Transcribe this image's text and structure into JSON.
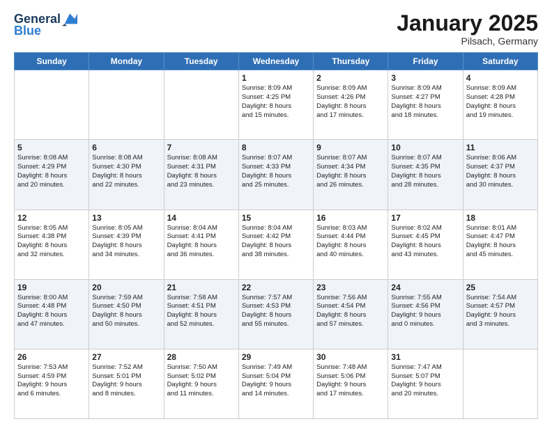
{
  "header": {
    "logo_line1": "General",
    "logo_line2": "Blue",
    "month_title": "January 2025",
    "location": "Pilsach, Germany"
  },
  "days_of_week": [
    "Sunday",
    "Monday",
    "Tuesday",
    "Wednesday",
    "Thursday",
    "Friday",
    "Saturday"
  ],
  "weeks": [
    [
      {
        "day": "",
        "info": ""
      },
      {
        "day": "",
        "info": ""
      },
      {
        "day": "",
        "info": ""
      },
      {
        "day": "1",
        "info": "Sunrise: 8:09 AM\nSunset: 4:25 PM\nDaylight: 8 hours\nand 15 minutes."
      },
      {
        "day": "2",
        "info": "Sunrise: 8:09 AM\nSunset: 4:26 PM\nDaylight: 8 hours\nand 17 minutes."
      },
      {
        "day": "3",
        "info": "Sunrise: 8:09 AM\nSunset: 4:27 PM\nDaylight: 8 hours\nand 18 minutes."
      },
      {
        "day": "4",
        "info": "Sunrise: 8:09 AM\nSunset: 4:28 PM\nDaylight: 8 hours\nand 19 minutes."
      }
    ],
    [
      {
        "day": "5",
        "info": "Sunrise: 8:08 AM\nSunset: 4:29 PM\nDaylight: 8 hours\nand 20 minutes."
      },
      {
        "day": "6",
        "info": "Sunrise: 8:08 AM\nSunset: 4:30 PM\nDaylight: 8 hours\nand 22 minutes."
      },
      {
        "day": "7",
        "info": "Sunrise: 8:08 AM\nSunset: 4:31 PM\nDaylight: 8 hours\nand 23 minutes."
      },
      {
        "day": "8",
        "info": "Sunrise: 8:07 AM\nSunset: 4:33 PM\nDaylight: 8 hours\nand 25 minutes."
      },
      {
        "day": "9",
        "info": "Sunrise: 8:07 AM\nSunset: 4:34 PM\nDaylight: 8 hours\nand 26 minutes."
      },
      {
        "day": "10",
        "info": "Sunrise: 8:07 AM\nSunset: 4:35 PM\nDaylight: 8 hours\nand 28 minutes."
      },
      {
        "day": "11",
        "info": "Sunrise: 8:06 AM\nSunset: 4:37 PM\nDaylight: 8 hours\nand 30 minutes."
      }
    ],
    [
      {
        "day": "12",
        "info": "Sunrise: 8:05 AM\nSunset: 4:38 PM\nDaylight: 8 hours\nand 32 minutes."
      },
      {
        "day": "13",
        "info": "Sunrise: 8:05 AM\nSunset: 4:39 PM\nDaylight: 8 hours\nand 34 minutes."
      },
      {
        "day": "14",
        "info": "Sunrise: 8:04 AM\nSunset: 4:41 PM\nDaylight: 8 hours\nand 36 minutes."
      },
      {
        "day": "15",
        "info": "Sunrise: 8:04 AM\nSunset: 4:42 PM\nDaylight: 8 hours\nand 38 minutes."
      },
      {
        "day": "16",
        "info": "Sunrise: 8:03 AM\nSunset: 4:44 PM\nDaylight: 8 hours\nand 40 minutes."
      },
      {
        "day": "17",
        "info": "Sunrise: 8:02 AM\nSunset: 4:45 PM\nDaylight: 8 hours\nand 43 minutes."
      },
      {
        "day": "18",
        "info": "Sunrise: 8:01 AM\nSunset: 4:47 PM\nDaylight: 8 hours\nand 45 minutes."
      }
    ],
    [
      {
        "day": "19",
        "info": "Sunrise: 8:00 AM\nSunset: 4:48 PM\nDaylight: 8 hours\nand 47 minutes."
      },
      {
        "day": "20",
        "info": "Sunrise: 7:59 AM\nSunset: 4:50 PM\nDaylight: 8 hours\nand 50 minutes."
      },
      {
        "day": "21",
        "info": "Sunrise: 7:58 AM\nSunset: 4:51 PM\nDaylight: 8 hours\nand 52 minutes."
      },
      {
        "day": "22",
        "info": "Sunrise: 7:57 AM\nSunset: 4:53 PM\nDaylight: 8 hours\nand 55 minutes."
      },
      {
        "day": "23",
        "info": "Sunrise: 7:56 AM\nSunset: 4:54 PM\nDaylight: 8 hours\nand 57 minutes."
      },
      {
        "day": "24",
        "info": "Sunrise: 7:55 AM\nSunset: 4:56 PM\nDaylight: 9 hours\nand 0 minutes."
      },
      {
        "day": "25",
        "info": "Sunrise: 7:54 AM\nSunset: 4:57 PM\nDaylight: 9 hours\nand 3 minutes."
      }
    ],
    [
      {
        "day": "26",
        "info": "Sunrise: 7:53 AM\nSunset: 4:59 PM\nDaylight: 9 hours\nand 6 minutes."
      },
      {
        "day": "27",
        "info": "Sunrise: 7:52 AM\nSunset: 5:01 PM\nDaylight: 9 hours\nand 8 minutes."
      },
      {
        "day": "28",
        "info": "Sunrise: 7:50 AM\nSunset: 5:02 PM\nDaylight: 9 hours\nand 11 minutes."
      },
      {
        "day": "29",
        "info": "Sunrise: 7:49 AM\nSunset: 5:04 PM\nDaylight: 9 hours\nand 14 minutes."
      },
      {
        "day": "30",
        "info": "Sunrise: 7:48 AM\nSunset: 5:06 PM\nDaylight: 9 hours\nand 17 minutes."
      },
      {
        "day": "31",
        "info": "Sunrise: 7:47 AM\nSunset: 5:07 PM\nDaylight: 9 hours\nand 20 minutes."
      },
      {
        "day": "",
        "info": ""
      }
    ]
  ]
}
